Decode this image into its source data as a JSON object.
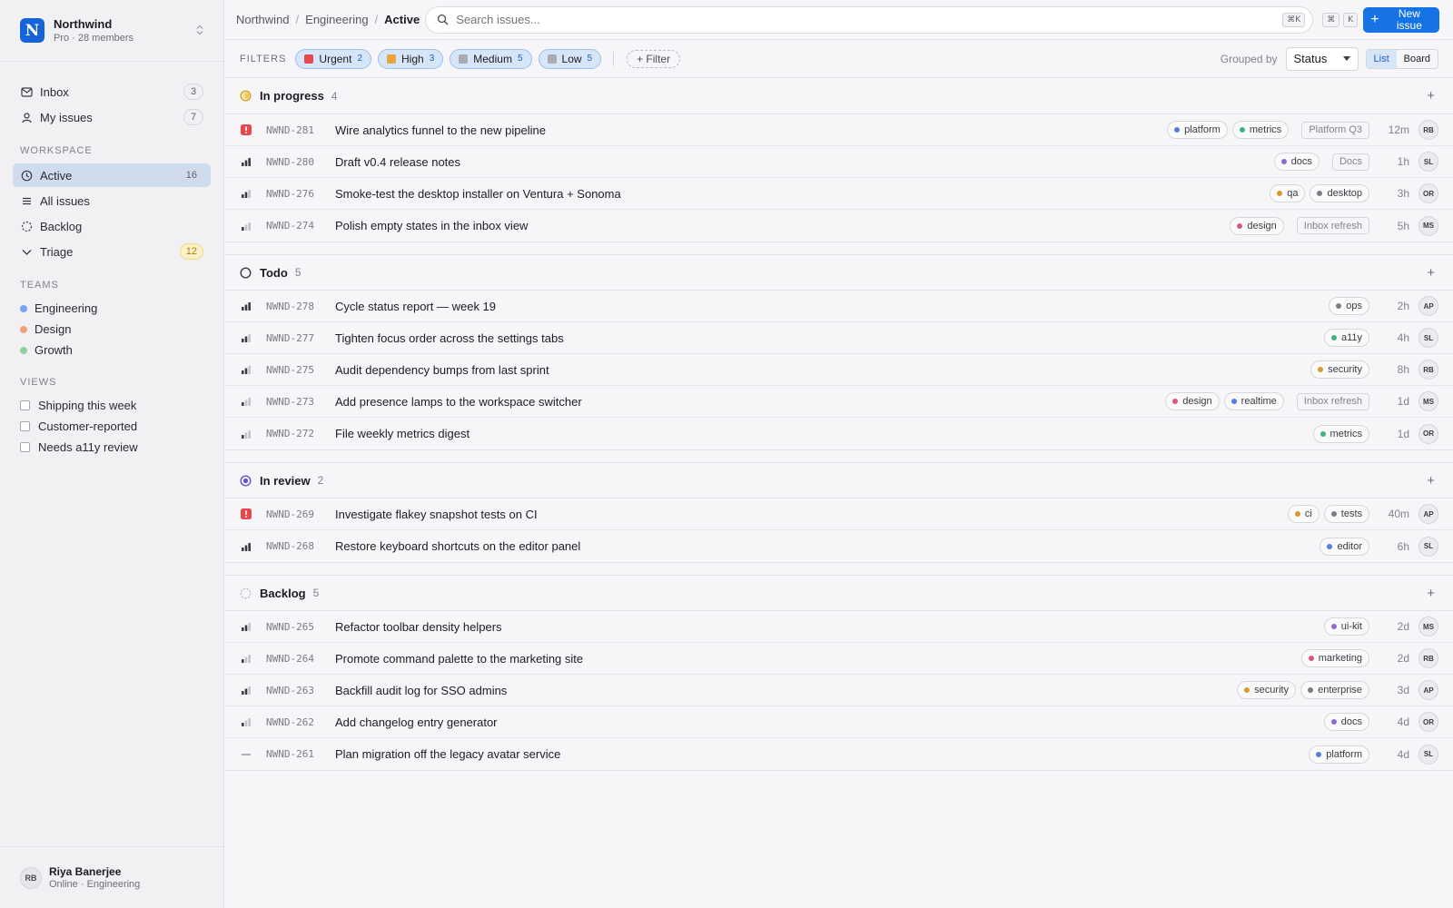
{
  "workspace": {
    "name": "Northwind",
    "logo_letter": "N",
    "plan": "Pro · 28 members"
  },
  "nav": {
    "inbox": {
      "label": "Inbox",
      "count": "3"
    },
    "my_issues": {
      "label": "My issues",
      "count": "7"
    }
  },
  "workspace_section": {
    "label": "Workspace",
    "items": [
      {
        "label": "Active",
        "count": "16",
        "icon": "clock-icon"
      },
      {
        "label": "All issues",
        "icon": "list-icon"
      },
      {
        "label": "Backlog",
        "icon": "dashed-circle-icon"
      },
      {
        "label": "Triage",
        "count": "12",
        "icon": "chevron-down-icon"
      }
    ]
  },
  "teams": {
    "label": "Teams",
    "items": [
      {
        "label": "Engineering",
        "color": "#7aa5f0"
      },
      {
        "label": "Design",
        "color": "#f0a37a"
      },
      {
        "label": "Growth",
        "color": "#8fd19e"
      }
    ]
  },
  "views": {
    "label": "Views",
    "items": [
      {
        "label": "Shipping this week"
      },
      {
        "label": "Customer-reported"
      },
      {
        "label": "Needs a11y review"
      }
    ]
  },
  "user": {
    "initials": "RB",
    "name": "Riya Banerjee",
    "status": "Online · Engineering"
  },
  "breadcrumb": {
    "root": "Northwind",
    "team": "Engineering",
    "current": "Active"
  },
  "search": {
    "placeholder": "Search issues...",
    "shortcut": "⌘K"
  },
  "shortcuts": {
    "key1": "⌘",
    "key2": "K"
  },
  "new_issue": {
    "label": "New issue"
  },
  "filters": {
    "label": "Filters",
    "chips": [
      {
        "label": "Urgent",
        "count": "2",
        "color": "#e5484d"
      },
      {
        "label": "High",
        "count": "3",
        "color": "#e8a33d"
      },
      {
        "label": "Medium",
        "count": "5",
        "color": "#a9abb2"
      },
      {
        "label": "Low",
        "count": "5",
        "color": "#a9abb2"
      }
    ],
    "add_label": "+ Filter"
  },
  "grouping": {
    "label": "Grouped by",
    "value": "Status"
  },
  "view_toggle": {
    "list": "List",
    "board": "Board"
  },
  "accent": "#1573e6",
  "groups": [
    {
      "name": "In progress",
      "count": "4",
      "icon": "in-progress-icon",
      "issues": [
        {
          "id": "NWND-281",
          "title": "Wire analytics funnel to the new pipeline",
          "priority": "urgent",
          "tags": [
            {
              "name": "platform",
              "color": "#4f7fe0"
            },
            {
              "name": "metrics",
              "color": "#3fb37f"
            }
          ],
          "project": "Platform Q3",
          "age": "12m",
          "assignee": "RB"
        },
        {
          "id": "NWND-280",
          "title": "Draft v0.4 release notes",
          "priority": "high",
          "tags": [
            {
              "name": "docs",
              "color": "#8e6bd1"
            }
          ],
          "project": "Docs",
          "age": "1h",
          "assignee": "SL"
        },
        {
          "id": "NWND-276",
          "title": "Smoke-test the desktop installer on Ventura + Sonoma",
          "priority": "medium",
          "tags": [
            {
              "name": "qa",
              "color": "#d89a2b"
            },
            {
              "name": "desktop",
              "color": "#7a7d85"
            }
          ],
          "project": "",
          "age": "3h",
          "assignee": "OR"
        },
        {
          "id": "NWND-274",
          "title": "Polish empty states in the inbox view",
          "priority": "low",
          "tags": [
            {
              "name": "design",
              "color": "#d9587e"
            }
          ],
          "project": "Inbox refresh",
          "age": "5h",
          "assignee": "MS"
        }
      ]
    },
    {
      "name": "Todo",
      "count": "5",
      "icon": "todo-circle-icon",
      "issues": [
        {
          "id": "NWND-278",
          "title": "Cycle status report — week 19",
          "priority": "high",
          "tags": [
            {
              "name": "ops",
              "color": "#7a7d85"
            }
          ],
          "project": "",
          "age": "2h",
          "assignee": "AP"
        },
        {
          "id": "NWND-277",
          "title": "Tighten focus order across the settings tabs",
          "priority": "medium",
          "tags": [
            {
              "name": "a11y",
              "color": "#3fb37f"
            }
          ],
          "project": "",
          "age": "4h",
          "assignee": "SL"
        },
        {
          "id": "NWND-275",
          "title": "Audit dependency bumps from last sprint",
          "priority": "medium",
          "tags": [
            {
              "name": "security",
              "color": "#d89a2b"
            }
          ],
          "project": "",
          "age": "8h",
          "assignee": "RB"
        },
        {
          "id": "NWND-273",
          "title": "Add presence lamps to the workspace switcher",
          "priority": "low",
          "tags": [
            {
              "name": "design",
              "color": "#d9587e"
            },
            {
              "name": "realtime",
              "color": "#4f7fe0"
            }
          ],
          "project": "Inbox refresh",
          "age": "1d",
          "assignee": "MS"
        },
        {
          "id": "NWND-272",
          "title": "File weekly metrics digest",
          "priority": "low",
          "tags": [
            {
              "name": "metrics",
              "color": "#3fb37f"
            }
          ],
          "project": "",
          "age": "1d",
          "assignee": "OR"
        }
      ]
    },
    {
      "name": "In review",
      "count": "2",
      "icon": "in-review-icon",
      "issues": [
        {
          "id": "NWND-269",
          "title": "Investigate flakey snapshot tests on CI",
          "priority": "urgent",
          "tags": [
            {
              "name": "ci",
              "color": "#d89a2b"
            },
            {
              "name": "tests",
              "color": "#7a7d85"
            }
          ],
          "project": "",
          "age": "40m",
          "assignee": "AP"
        },
        {
          "id": "NWND-268",
          "title": "Restore keyboard shortcuts on the editor panel",
          "priority": "high",
          "tags": [
            {
              "name": "editor",
              "color": "#4f7fe0"
            }
          ],
          "project": "",
          "age": "6h",
          "assignee": "SL"
        }
      ]
    },
    {
      "name": "Backlog",
      "count": "5",
      "icon": "backlog-dashed-icon",
      "issues": [
        {
          "id": "NWND-265",
          "title": "Refactor toolbar density helpers",
          "priority": "medium",
          "tags": [
            {
              "name": "ui-kit",
              "color": "#8e6bd1"
            }
          ],
          "project": "",
          "age": "2d",
          "assignee": "MS"
        },
        {
          "id": "NWND-264",
          "title": "Promote command palette to the marketing site",
          "priority": "low",
          "tags": [
            {
              "name": "marketing",
              "color": "#d9587e"
            }
          ],
          "project": "",
          "age": "2d",
          "assignee": "RB"
        },
        {
          "id": "NWND-263",
          "title": "Backfill audit log for SSO admins",
          "priority": "medium",
          "tags": [
            {
              "name": "security",
              "color": "#d89a2b"
            },
            {
              "name": "enterprise",
              "color": "#7a7d85"
            }
          ],
          "project": "",
          "age": "3d",
          "assignee": "AP"
        },
        {
          "id": "NWND-262",
          "title": "Add changelog entry generator",
          "priority": "low",
          "tags": [
            {
              "name": "docs",
              "color": "#8e6bd1"
            }
          ],
          "project": "",
          "age": "4d",
          "assignee": "OR"
        },
        {
          "id": "NWND-261",
          "title": "Plan migration off the legacy avatar service",
          "priority": "none",
          "tags": [
            {
              "name": "platform",
              "color": "#4f7fe0"
            }
          ],
          "project": "",
          "age": "4d",
          "assignee": "SL"
        }
      ]
    }
  ]
}
